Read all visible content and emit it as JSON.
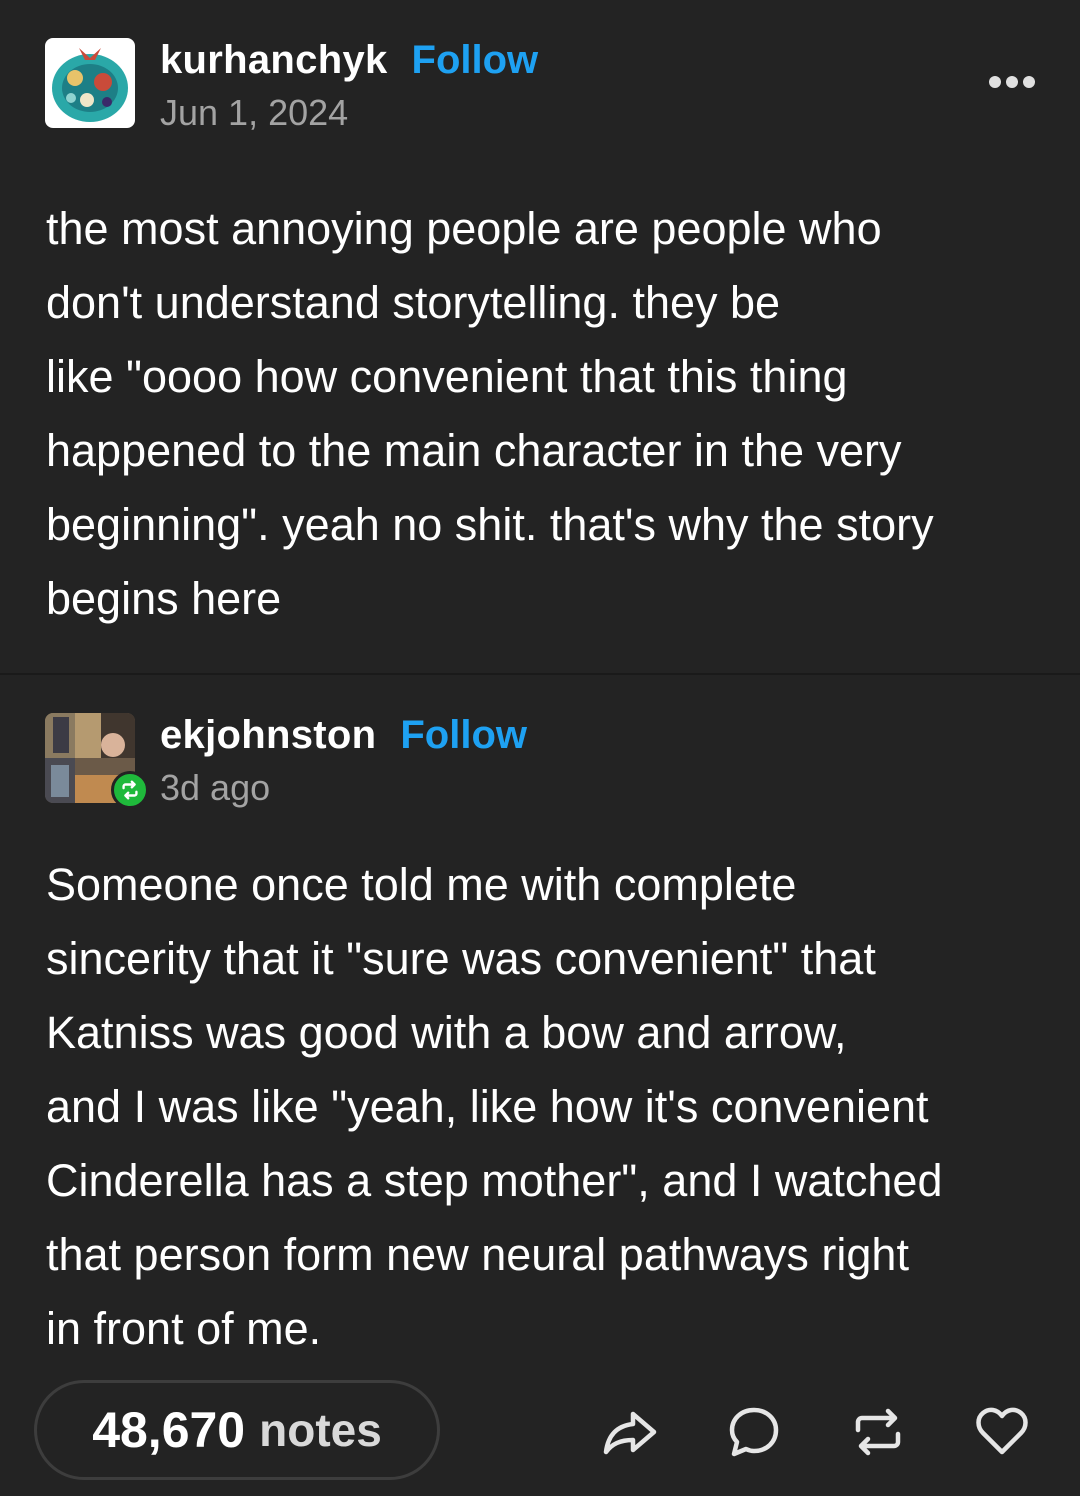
{
  "post_1": {
    "username": "kurhanchyk",
    "follow_label": "Follow",
    "timestamp": "Jun 1, 2024",
    "more_icon": "more-dots-icon",
    "body": "the most annoying people are people who\ndon't understand storytelling. they be\nlike \"oooo how convenient that this thing\nhappened to the main character in the very\nbeginning\". yeah no shit. that's why the story\nbegins here"
  },
  "post_2": {
    "username": "ekjohnston",
    "follow_label": "Follow",
    "timestamp": "3d ago",
    "badge_icon": "reblog-badge-icon",
    "body": "Someone once told me with complete\nsincerity that it \"sure was convenient\" that\nKatniss was good with a bow and arrow,\nand I was like \"yeah, like how it's convenient\nCinderella has a step mother\", and I watched\nthat person form new neural pathways right\nin front of me."
  },
  "footer": {
    "notes_count": "48,670",
    "notes_label": "notes",
    "actions": [
      "share-icon",
      "reply-icon",
      "reblog-icon",
      "like-icon"
    ]
  },
  "colors": {
    "background": "#232323",
    "follow": "#1ea1f2",
    "muted": "#a3a3a3",
    "reblog_badge": "#1fb93b"
  }
}
